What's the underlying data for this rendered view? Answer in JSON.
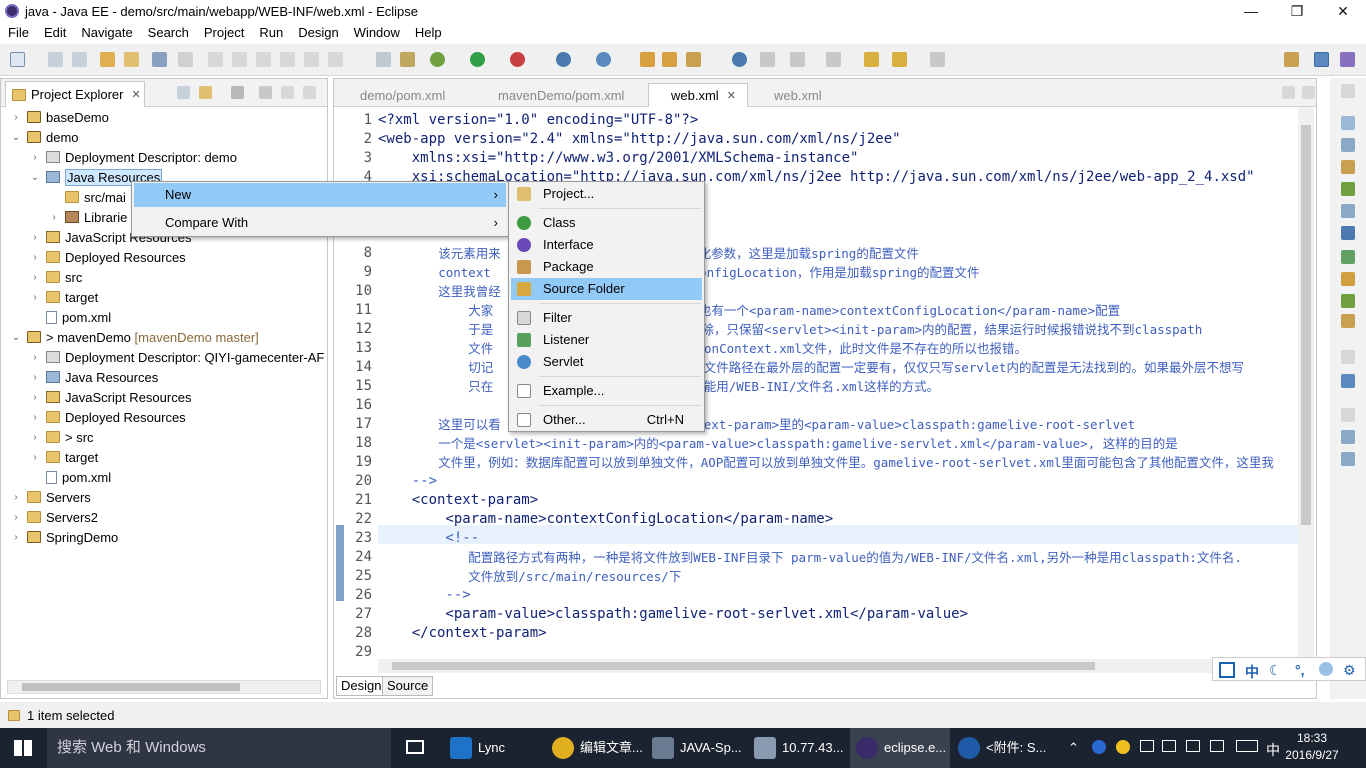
{
  "window": {
    "title": "java - Java EE - demo/src/main/webapp/WEB-INF/web.xml - Eclipse",
    "min": "—",
    "max": "❐",
    "close": "✕"
  },
  "menu": [
    "File",
    "Edit",
    "Navigate",
    "Search",
    "Project",
    "Run",
    "Design",
    "Window",
    "Help"
  ],
  "toolbar": {
    "quick_access": "Quick Access"
  },
  "project_explorer": {
    "tab_label": "Project Explorer",
    "close": "✕",
    "items": [
      {
        "label": "baseDemo",
        "twisty": "›"
      },
      {
        "label": "demo",
        "twisty": "⌄"
      },
      {
        "label": "Deployment Descriptor: demo",
        "twisty": "›"
      },
      {
        "label": "Java Resources",
        "twisty": "⌄"
      },
      {
        "label": "src/mai",
        "twisty": ""
      },
      {
        "label": "Librarie",
        "twisty": "›"
      },
      {
        "label": "JavaScript Resources",
        "twisty": "›"
      },
      {
        "label": "Deployed Resources",
        "twisty": "›"
      },
      {
        "label": "src",
        "twisty": "›"
      },
      {
        "label": "target",
        "twisty": "›"
      },
      {
        "label": "pom.xml",
        "twisty": ""
      },
      {
        "label": "> mavenDemo",
        "annotation": "[mavenDemo master]",
        "twisty": "⌄"
      },
      {
        "label": "Deployment Descriptor: QIYI-gamecenter-AF",
        "twisty": "›"
      },
      {
        "label": "Java Resources",
        "twisty": "›"
      },
      {
        "label": "JavaScript Resources",
        "twisty": "›"
      },
      {
        "label": "Deployed Resources",
        "twisty": "›"
      },
      {
        "label": "> src",
        "twisty": "›"
      },
      {
        "label": "target",
        "twisty": "›"
      },
      {
        "label": "pom.xml",
        "twisty": ""
      },
      {
        "label": "Servers",
        "twisty": "›"
      },
      {
        "label": "Servers2",
        "twisty": "›"
      },
      {
        "label": "SpringDemo",
        "twisty": "›"
      }
    ]
  },
  "editor": {
    "tabs": [
      {
        "label": "demo/pom.xml"
      },
      {
        "label": "mavenDemo/pom.xml"
      },
      {
        "label": "web.xml",
        "close": "✕"
      },
      {
        "label": "web.xml"
      }
    ],
    "lines": [
      {
        "n": "1",
        "t": "<?xml version=\"1.0\" encoding=\"UTF-8\"?>"
      },
      {
        "n": "2",
        "t": "<web-app version=\"2.4\" xmlns=\"http://java.sun.com/xml/ns/j2ee\""
      },
      {
        "n": "3",
        "t": "    xmlns:xsi=\"http://www.w3.org/2001/XMLSchema-instance\""
      },
      {
        "n": "4",
        "t": "    xsi:schemaLocation=\"http://java.sun.com/xml/ns/j2ee http://java.sun.com/xml/ns/j2ee/web-app_2_4.xsd\""
      },
      {
        "n": "",
        "t": ">"
      },
      {
        "n": "",
        "t": ""
      },
      {
        "n": "",
        "t": ""
      },
      {
        "n": "8",
        "t": "        该元素用来                  上下文初始化参数，这里是加载spring的配置文件"
      },
      {
        "n": "9",
        "t": "        context                  是contextConfigLocation，作用是加载spring的配置文件"
      },
      {
        "n": "10",
        "t": "        这里我曾经"
      },
      {
        "n": "11",
        "t": "            大家                  param>里面也有一个<param-name>contextConfigLocation</param-name>配置"
      },
      {
        "n": "12",
        "t": "            于是                  t-param>删除，只保留<servlet><init-param>内的配置，结果运行时候报错说找不到classpath"
      },
      {
        "n": "13",
        "t": "            文件                  /applicationContext.xml文件，此时文件是不存在的所以也报错。"
      },
      {
        "n": "14",
        "t": "            切记                  这配置文件，文件路径在最外层的配置一定要有，仅仅只写servlet内的配置是无法找到的。如果最外层不想写"
      },
      {
        "n": "15",
        "t": "            只在                  配置文件，只能用/WEB-INI/文件名.xml这样的方式。"
      },
      {
        "n": "16",
        "t": ""
      },
      {
        "n": "17",
        "t": "        这里可以看                 一个是<context-param>里的<param-value>classpath:gamelive-root-serlvet"
      },
      {
        "n": "18",
        "t": "        一个是<servlet><init-param>内的<param-value>classpath:gamelive-servlet.xml</param-value>, 这样的目的是"
      },
      {
        "n": "19",
        "t": "        文件里，例如：数据库配置可以放到单独文件，AOP配置可以放到单独文件里。gamelive-root-serlvet.xml里面可能包含了其他配置文件，这里我"
      },
      {
        "n": "20",
        "t": "    -->"
      },
      {
        "n": "21",
        "t": "    <context-param>"
      },
      {
        "n": "22",
        "t": "        <param-name>contextConfigLocation</param-name>"
      },
      {
        "n": "23",
        "t": "        <!--"
      },
      {
        "n": "24",
        "t": "            配置路径方式有两种，一种是将文件放到WEB-INF目录下 parm-value的值为/WEB-INF/文件名.xml,另外一种是用classpath:文件名."
      },
      {
        "n": "25",
        "t": "            文件放到/src/main/resources/下"
      },
      {
        "n": "26",
        "t": "        -->"
      },
      {
        "n": "27",
        "t": "        <param-value>classpath:gamelive-root-serlvet.xml</param-value>"
      },
      {
        "n": "28",
        "t": "    </context-param>"
      },
      {
        "n": "29",
        "t": ""
      }
    ],
    "bottom_tabs": [
      "Design",
      "Source"
    ]
  },
  "context_menu": {
    "items": [
      {
        "label": "New",
        "arrow": "›"
      },
      {
        "label": "Compare With",
        "arrow": "›"
      }
    ]
  },
  "submenu": {
    "items": [
      {
        "label": "Project...",
        "icon": "project-icon"
      },
      {
        "label": "Class",
        "icon": "class-icon"
      },
      {
        "label": "Interface",
        "icon": "interface-icon"
      },
      {
        "label": "Package",
        "icon": "package-icon"
      },
      {
        "label": "Source Folder",
        "icon": "source-folder-icon"
      },
      {
        "label": "Filter",
        "icon": "filter-icon"
      },
      {
        "label": "Listener",
        "icon": "listener-icon"
      },
      {
        "label": "Servlet",
        "icon": "servlet-icon"
      },
      {
        "label": "Example...",
        "icon": "example-icon"
      },
      {
        "label": "Other...",
        "icon": "other-icon",
        "shortcut": "Ctrl+N"
      }
    ]
  },
  "status": {
    "text": "1 item selected"
  },
  "ime": [
    "中",
    "☾",
    "°,",
    "⚙"
  ],
  "taskbar": {
    "search_placeholder": "搜索 Web 和 Windows",
    "apps": [
      {
        "label": "Lync"
      },
      {
        "label": "编辑文章..."
      },
      {
        "label": "JAVA-Sp..."
      },
      {
        "label": "10.77.43..."
      },
      {
        "label": "eclipse.e..."
      },
      {
        "label": "<附件: S..."
      }
    ],
    "tray_lang": "中",
    "time": "18:33",
    "date": "2016/9/27"
  },
  "colors": {
    "selection": "#91c9f7",
    "tag": "#3f7f7f",
    "string": "#2a00ff",
    "comment": "#3f5fbf",
    "taskbar": "#1c2330"
  }
}
